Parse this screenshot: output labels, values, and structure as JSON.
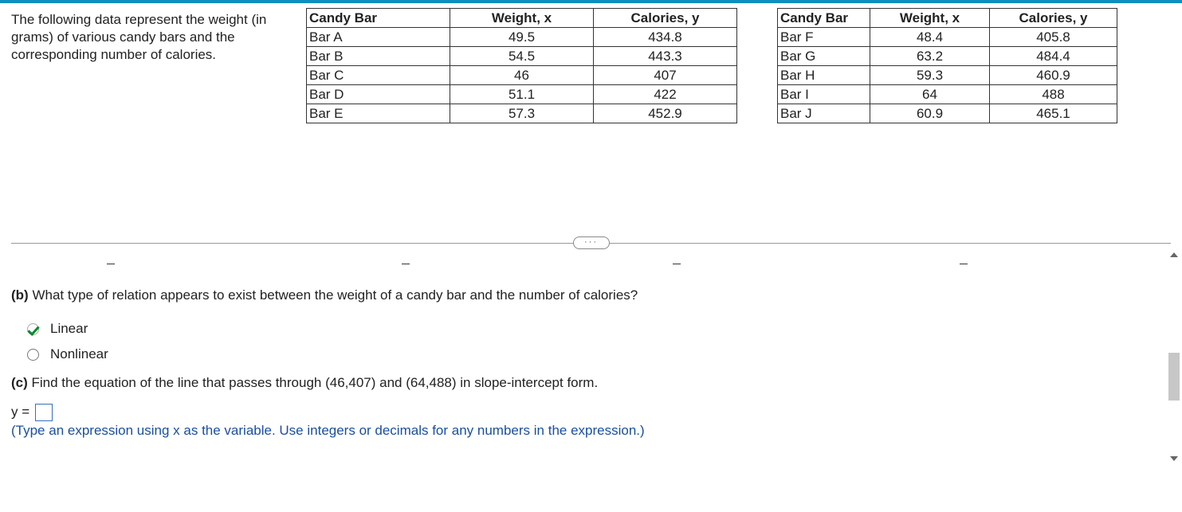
{
  "intro": "The following data represent the weight (in grams) of various candy bars and the corresponding number of calories.",
  "table_headers": {
    "c1": "Candy Bar",
    "c2": "Weight, x",
    "c3": "Calories, y"
  },
  "table1_rows": [
    {
      "name": "Bar A",
      "weight": "49.5",
      "cal": "434.8"
    },
    {
      "name": "Bar B",
      "weight": "54.5",
      "cal": "443.3"
    },
    {
      "name": "Bar C",
      "weight": "46",
      "cal": "407"
    },
    {
      "name": "Bar D",
      "weight": "51.1",
      "cal": "422"
    },
    {
      "name": "Bar E",
      "weight": "57.3",
      "cal": "452.9"
    }
  ],
  "table2_rows": [
    {
      "name": "Bar F",
      "weight": "48.4",
      "cal": "405.8"
    },
    {
      "name": "Bar G",
      "weight": "63.2",
      "cal": "484.4"
    },
    {
      "name": "Bar H",
      "weight": "59.3",
      "cal": "460.9"
    },
    {
      "name": "Bar I",
      "weight": "64",
      "cal": "488"
    },
    {
      "name": "Bar J",
      "weight": "60.9",
      "cal": "465.1"
    }
  ],
  "divider_pill": "···",
  "part_b": {
    "label": "(b)",
    "question": " What type of relation appears to exist between the weight of a candy bar and the number of calories?",
    "option1": "Linear",
    "option2": "Nonlinear",
    "selected": "option1"
  },
  "part_c": {
    "label": "(c)",
    "question": " Find the equation of the line that passes through (46,407) and (64,488) in slope-intercept form.",
    "prefix": "y =",
    "hint": "(Type an expression using x as the variable. Use integers or decimals for any numbers in the expression.)"
  },
  "chart_data": {
    "type": "table",
    "title": "Candy bar weight vs. calories",
    "columns": [
      "Candy Bar",
      "Weight, x",
      "Calories, y"
    ],
    "rows": [
      [
        "Bar A",
        49.5,
        434.8
      ],
      [
        "Bar B",
        54.5,
        443.3
      ],
      [
        "Bar C",
        46,
        407
      ],
      [
        "Bar D",
        51.1,
        422
      ],
      [
        "Bar E",
        57.3,
        452.9
      ],
      [
        "Bar F",
        48.4,
        405.8
      ],
      [
        "Bar G",
        63.2,
        484.4
      ],
      [
        "Bar H",
        59.3,
        460.9
      ],
      [
        "Bar I",
        64,
        488
      ],
      [
        "Bar J",
        60.9,
        465.1
      ]
    ]
  }
}
